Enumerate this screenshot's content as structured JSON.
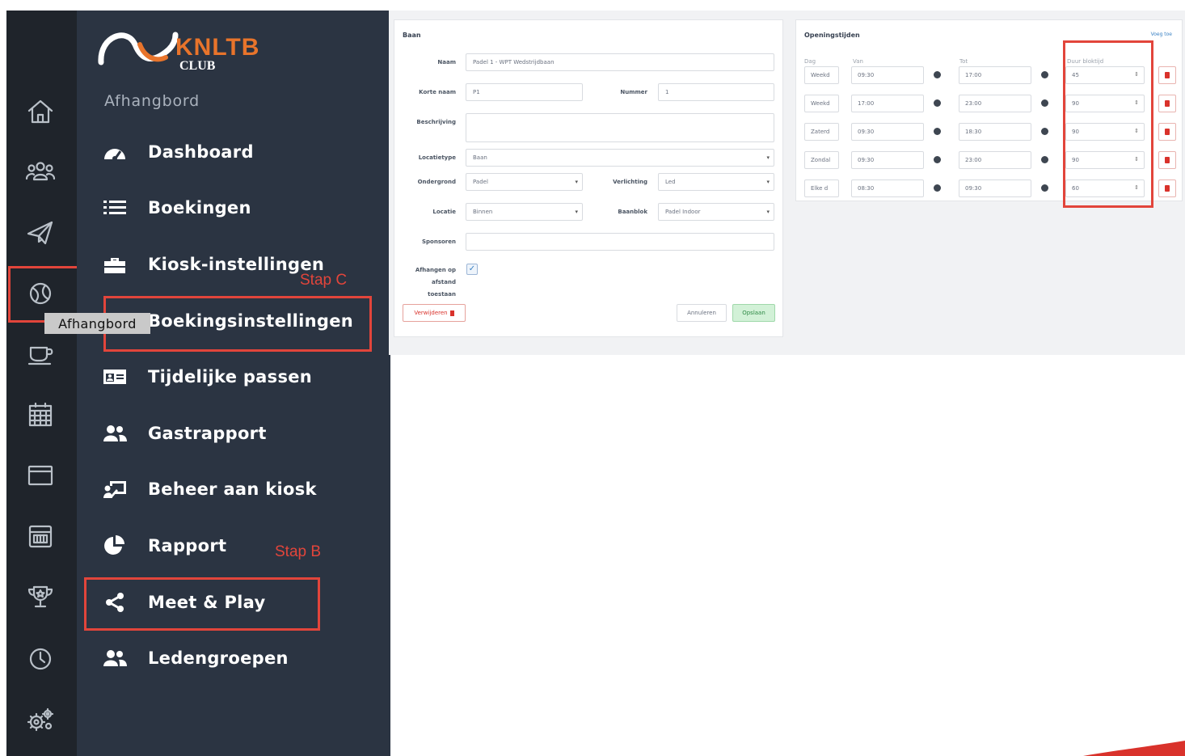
{
  "brand": {
    "name": "KNLTB",
    "sub": "CLUB",
    "color": "#e8742b"
  },
  "rail": {
    "icons": [
      "home-icon",
      "members-icon",
      "send-icon",
      "tennis-ball-icon",
      "coffee-cup-icon",
      "building-icon",
      "browser-window-icon",
      "calculator-icon",
      "trophy-icon",
      "clock-icon",
      "settings-gears-icon"
    ],
    "active": "tennis-ball-icon"
  },
  "nav": {
    "section": "Afhangbord",
    "items": [
      {
        "label": "Dashboard",
        "icon": "speedometer-icon"
      },
      {
        "label": "Boekingen",
        "icon": "list-icon"
      },
      {
        "label": "Kiosk-instellingen",
        "icon": "toolbox-icon"
      },
      {
        "label": "Boekingsinstellingen",
        "icon": "cog-icon"
      },
      {
        "label": "Tijdelijke passen",
        "icon": "id-card-icon"
      },
      {
        "label": "Gastrapport",
        "icon": "users-icon"
      },
      {
        "label": "Beheer aan kiosk",
        "icon": "presenter-icon"
      },
      {
        "label": "Rapport",
        "icon": "pie-chart-icon"
      },
      {
        "label": "Meet & Play",
        "icon": "share-icon"
      },
      {
        "label": "Ledengroepen",
        "icon": "users-group-icon"
      }
    ]
  },
  "tooltip": "Afhangbord",
  "annotations": {
    "step_c": "Stap C",
    "step_b": "Stap B",
    "color": "#e2453b"
  },
  "baan_form": {
    "title": "Baan",
    "naam_label": "Naam",
    "naam_value": "Padel 1 - WPT Wedstrijdbaan",
    "korte_naam_label": "Korte naam",
    "korte_naam_value": "P1",
    "nummer_label": "Nummer",
    "nummer_value": "1",
    "beschrijving_label": "Beschrijving",
    "beschrijving_value": "",
    "locatietype_label": "Locatietype",
    "locatietype_value": "Baan",
    "ondergrond_label": "Ondergrond",
    "ondergrond_value": "Padel",
    "verlichting_label": "Verlichting",
    "verlichting_value": "Led",
    "locatie_label": "Locatie",
    "locatie_value": "Binnen",
    "baanblok_label": "Baanblok",
    "baanblok_value": "Padel Indoor",
    "sponsoren_label": "Sponsoren",
    "sponsoren_value": "",
    "afhangen_label": [
      "Afhangen op",
      "afstand",
      "toestaan"
    ],
    "afhangen_checked": true,
    "delete_label": "Verwijderen",
    "cancel_label": "Annuleren",
    "save_label": "Opslaan"
  },
  "opening_hours": {
    "title": "Openingstijden",
    "add_label": "Voeg toe",
    "headers": [
      "Dag",
      "Van",
      "Tot",
      "Duur bloktijd"
    ],
    "rows": [
      {
        "dag": "Weekd",
        "van": "09:30",
        "tot": "17:00",
        "duur": "45"
      },
      {
        "dag": "Weekd",
        "van": "17:00",
        "tot": "23:00",
        "duur": "90"
      },
      {
        "dag": "Zaterd",
        "van": "09:30",
        "tot": "18:30",
        "duur": "90"
      },
      {
        "dag": "Zondal",
        "van": "09:30",
        "tot": "23:00",
        "duur": "90"
      },
      {
        "dag": "Elke d",
        "van": "08:30",
        "tot": "09:30",
        "duur": "60"
      }
    ]
  }
}
